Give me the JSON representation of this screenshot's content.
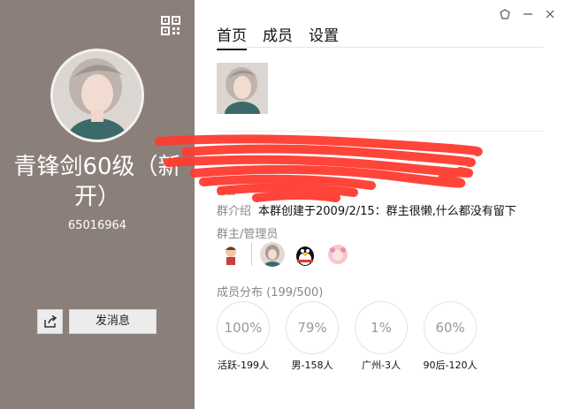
{
  "group": {
    "name": "青锋剑60级（新开）",
    "id": "65016964"
  },
  "left_actions": {
    "send_message": "发消息"
  },
  "tabs": [
    {
      "label": "首页",
      "active": true
    },
    {
      "label": "成员",
      "active": false
    },
    {
      "label": "设置",
      "active": false
    }
  ],
  "intro": {
    "label": "群介绍",
    "text": "本群创建于2009/2/15：群主很懒,什么都没有留下"
  },
  "admins_label": "群主/管理员",
  "distribution": {
    "label": "成员分布 (199/500)",
    "stats": [
      {
        "value": "100%",
        "caption": "活跃-199人"
      },
      {
        "value": "79%",
        "caption": "男-158人"
      },
      {
        "value": "1%",
        "caption": "广州-3人"
      },
      {
        "value": "60%",
        "caption": "90后-120人"
      }
    ]
  },
  "colors": {
    "left_panel": "#8b7f79",
    "redaction": "#ff3b30"
  }
}
